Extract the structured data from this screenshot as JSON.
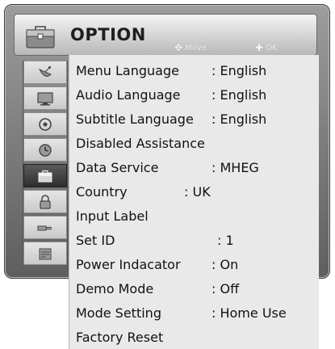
{
  "header": {
    "title": "OPTION",
    "hint_move_label": "Move",
    "hint_ok_label": "OK"
  },
  "sidebar": {
    "items": [
      {
        "icon": "satellite-dish-icon",
        "active": false
      },
      {
        "icon": "monitor-icon",
        "active": false
      },
      {
        "icon": "audio-disc-icon",
        "active": false
      },
      {
        "icon": "clock-icon",
        "active": false
      },
      {
        "icon": "option-toolbox-icon",
        "active": true
      },
      {
        "icon": "lock-icon",
        "active": false
      },
      {
        "icon": "input-plug-icon",
        "active": false
      },
      {
        "icon": "usb-media-icon",
        "active": false
      }
    ]
  },
  "menu": {
    "items": [
      {
        "label": "Menu Language",
        "value": ": English"
      },
      {
        "label": "Audio Language",
        "value": ": English"
      },
      {
        "label": "Subtitle Language",
        "value": ": English"
      },
      {
        "label": "Disabled Assistance",
        "value": ""
      },
      {
        "label": "Data Service",
        "value": ": MHEG"
      },
      {
        "label": "Country",
        "value": ": UK"
      },
      {
        "label": "Input Label",
        "value": ""
      },
      {
        "label": "Set ID",
        "value": ": 1"
      },
      {
        "label": "Power Indacator",
        "value": ": On"
      },
      {
        "label": "Demo Mode",
        "value": ": Off"
      },
      {
        "label": "Mode Setting",
        "value": ": Home Use"
      },
      {
        "label": "Factory Reset",
        "value": ""
      }
    ]
  }
}
